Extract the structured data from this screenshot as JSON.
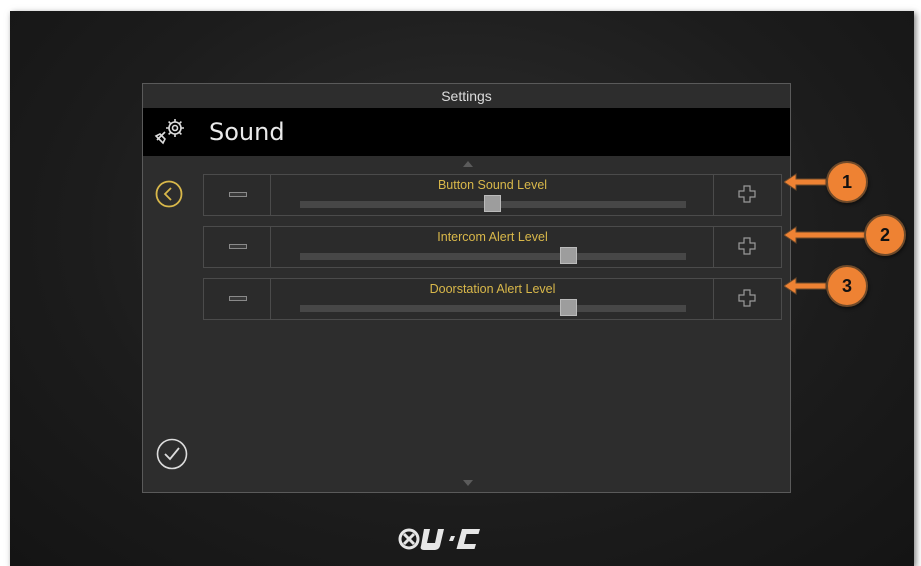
{
  "window": {
    "title": "Settings"
  },
  "header": {
    "title": "Sound",
    "icon": "wrench-gear-icon"
  },
  "nav": {
    "back_icon": "chevron-left-circle-icon",
    "confirm_icon": "checkmark-circle-icon"
  },
  "sliders": [
    {
      "label": "Button Sound Level",
      "level": 0.5
    },
    {
      "label": "Intercom Alert Level",
      "level": 0.7
    },
    {
      "label": "Doorstation Alert Level",
      "level": 0.7
    }
  ],
  "callouts": [
    "1",
    "2",
    "3"
  ],
  "brand": {
    "logo": "URC"
  },
  "colors": {
    "accent": "#d9b84a",
    "callout": "#ee8233",
    "header_bg": "#000000",
    "panel_bg": "#2d2d2d"
  }
}
